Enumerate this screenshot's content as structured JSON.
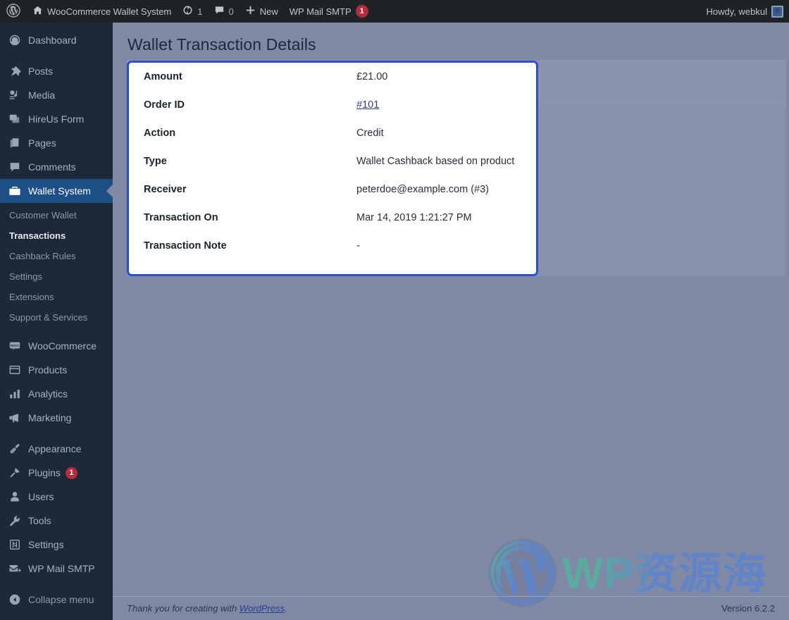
{
  "adminbar": {
    "logo_icon": "wordpress-logo-icon",
    "site_icon": "home-icon",
    "site_name": "WooCommerce Wallet System",
    "updates_icon": "updates-icon",
    "updates_count": "1",
    "comments_icon": "comment-bubble-icon",
    "comments_count": "0",
    "new_icon": "plus-icon",
    "new_label": "New",
    "smtp_label": "WP Mail SMTP",
    "smtp_badge": "1",
    "howdy": "Howdy, webkul",
    "avatar_icon": "avatar-icon",
    "badge_color": "#b32d3e"
  },
  "sidebar": {
    "items": [
      {
        "label": "Dashboard",
        "icon": "dashboard-icon",
        "active": false
      },
      {
        "label": "Posts",
        "icon": "pin-icon",
        "active": false
      },
      {
        "label": "Media",
        "icon": "media-icon",
        "active": false
      },
      {
        "label": "HireUs Form",
        "icon": "forms-icon",
        "active": false
      },
      {
        "label": "Pages",
        "icon": "pages-icon",
        "active": false
      },
      {
        "label": "Comments",
        "icon": "comments-icon",
        "active": false
      },
      {
        "label": "Wallet System",
        "icon": "wallet-icon",
        "active": true
      },
      {
        "label": "WooCommerce",
        "icon": "woocommerce-icon",
        "active": false
      },
      {
        "label": "Products",
        "icon": "products-icon",
        "active": false
      },
      {
        "label": "Analytics",
        "icon": "analytics-icon",
        "active": false
      },
      {
        "label": "Marketing",
        "icon": "marketing-icon",
        "active": false
      },
      {
        "label": "Appearance",
        "icon": "appearance-icon",
        "active": false
      },
      {
        "label": "Plugins",
        "icon": "plugins-icon",
        "active": false,
        "badge": "1"
      },
      {
        "label": "Users",
        "icon": "users-icon",
        "active": false
      },
      {
        "label": "Tools",
        "icon": "tools-icon",
        "active": false
      },
      {
        "label": "Settings",
        "icon": "settings-icon",
        "active": false
      },
      {
        "label": "WP Mail SMTP",
        "icon": "mail-icon",
        "active": false
      }
    ],
    "submenu": [
      {
        "label": "Customer Wallet",
        "current": false
      },
      {
        "label": "Transactions",
        "current": true
      },
      {
        "label": "Cashback Rules",
        "current": false
      },
      {
        "label": "Settings",
        "current": false
      },
      {
        "label": "Extensions",
        "current": false
      },
      {
        "label": "Support & Services",
        "current": false
      }
    ],
    "collapse": {
      "label": "Collapse menu",
      "icon": "collapse-arrow-icon"
    },
    "active_color": "#1d4e86",
    "background_color": "#1d2939"
  },
  "main": {
    "page_title": "Wallet Transaction Details",
    "card_border_color": "#2d4bd8",
    "rows": [
      {
        "label": "Amount",
        "value": "£21.00",
        "link": false
      },
      {
        "label": "Order ID",
        "value": "#101",
        "link": true
      },
      {
        "label": "Action",
        "value": "Credit",
        "link": false
      },
      {
        "label": "Type",
        "value": "Wallet Cashback based on product",
        "link": false
      },
      {
        "label": "Receiver",
        "value": "peterdoe@example.com (#3)",
        "link": false
      },
      {
        "label": "Transaction On",
        "value": "Mar 14, 2019 1:21:27 PM",
        "link": false
      },
      {
        "label": "Transaction Note",
        "value": "-",
        "link": false
      }
    ]
  },
  "watermark": {
    "text": "WP资源海",
    "logo_icon": "wordpress-logo-watermark-icon",
    "color_green": "#3ec79b",
    "color_blue": "#4a82e8"
  },
  "footer": {
    "thanks_prefix": "Thank you for creating with ",
    "wordpress_link": "WordPress",
    "thanks_suffix": ".",
    "version": "Version 6.2.2"
  }
}
